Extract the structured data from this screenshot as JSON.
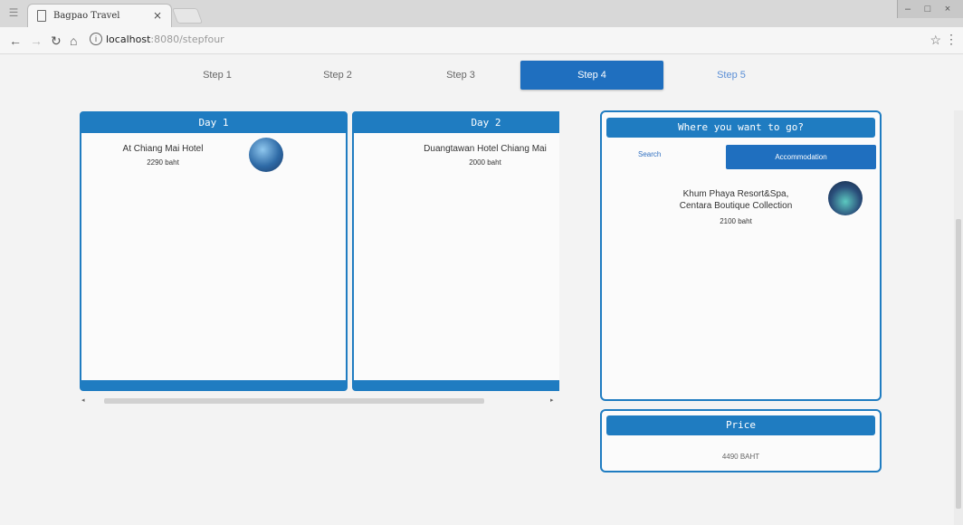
{
  "browser": {
    "tab_title": "Bagpao Travel",
    "tab_close": "×",
    "url_host": "localhost",
    "url_path": ":8080/stepfour",
    "window_buttons": [
      "–",
      "□",
      "×"
    ]
  },
  "steps": [
    {
      "label": "Step 1"
    },
    {
      "label": "Step 2"
    },
    {
      "label": "Step 3"
    },
    {
      "label": "Step 4"
    },
    {
      "label": "Step 5"
    }
  ],
  "active_step": 4,
  "days": [
    {
      "title": "Day 1",
      "hotel": "At Chiang Mai Hotel",
      "price": "2290 baht"
    },
    {
      "title": "Day 2",
      "hotel": "Duangtawan Hotel Chiang Mai",
      "price": "2000 baht"
    }
  ],
  "search_panel": {
    "title": "Where you want to go?",
    "tab_search": "Search",
    "tab_accommodation": "Accommodation",
    "result_name_line1": "Khum Phaya Resort&Spa,",
    "result_name_line2": "Centara Boutique Collection",
    "result_price": "2100 baht"
  },
  "price_panel": {
    "title": "Price",
    "total": "4490 BAHT"
  },
  "colors": {
    "accent": "#1f7cc1",
    "active_step": "#1f6fbf"
  }
}
